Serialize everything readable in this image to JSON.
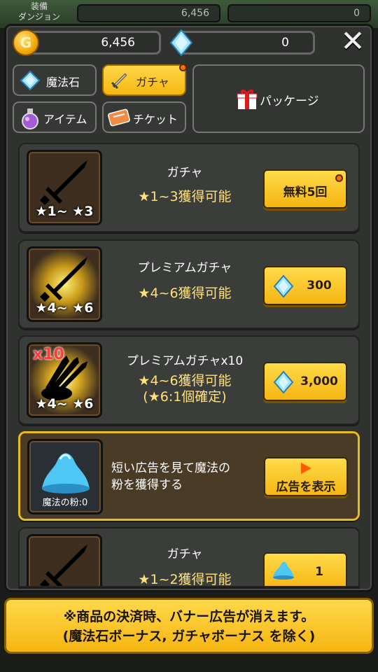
{
  "background_bar": {
    "title_line1": "装備",
    "title_line2": "ダンジョン",
    "gold": "6,456",
    "gems": "0"
  },
  "currency": {
    "gold": "6,456",
    "gems": "0"
  },
  "tabs": [
    {
      "label": "魔法石",
      "icon": "gem-icon"
    },
    {
      "label": "ガチャ",
      "icon": "sword-icon",
      "active": true
    },
    {
      "label": "アイテム",
      "icon": "potion-icon"
    },
    {
      "label": "チケット",
      "icon": "ticket-icon"
    }
  ],
  "package_tab": {
    "label": "パッケージ",
    "icon": "gift-icon"
  },
  "cards": [
    {
      "title": "ガチャ",
      "desc": "★1~3獲得可能",
      "stars": "★1~ ★3",
      "button": "無料5回"
    },
    {
      "title": "プレミアムガチャ",
      "desc": "★4~6獲得可能",
      "stars": "★4~ ★6",
      "button": "300"
    },
    {
      "title": "プレミアムガチャx10",
      "desc1": "★4~6獲得可能",
      "desc2": "(★6:1個確定)",
      "stars": "★4~ ★6",
      "badge": "x10",
      "button": "3,000"
    },
    {
      "desc1": "短い広告を見て魔法の",
      "desc2": "粉を獲得する",
      "powder": "魔法の粉:0",
      "button": "広告を表示"
    },
    {
      "title": "ガチャ",
      "desc": "★1~2獲得可能",
      "button": "1"
    }
  ],
  "notice": {
    "line1": "※商品の決済時、バナー広告が消えます。",
    "line2": "(魔法石ボーナス, ガチャボーナス を除く)"
  },
  "colors": {
    "accent": "#f5b512",
    "panel": "#2f322f",
    "card": "#3b3d3b",
    "gem": "#7fd8ff",
    "star": "#ffe07a"
  }
}
